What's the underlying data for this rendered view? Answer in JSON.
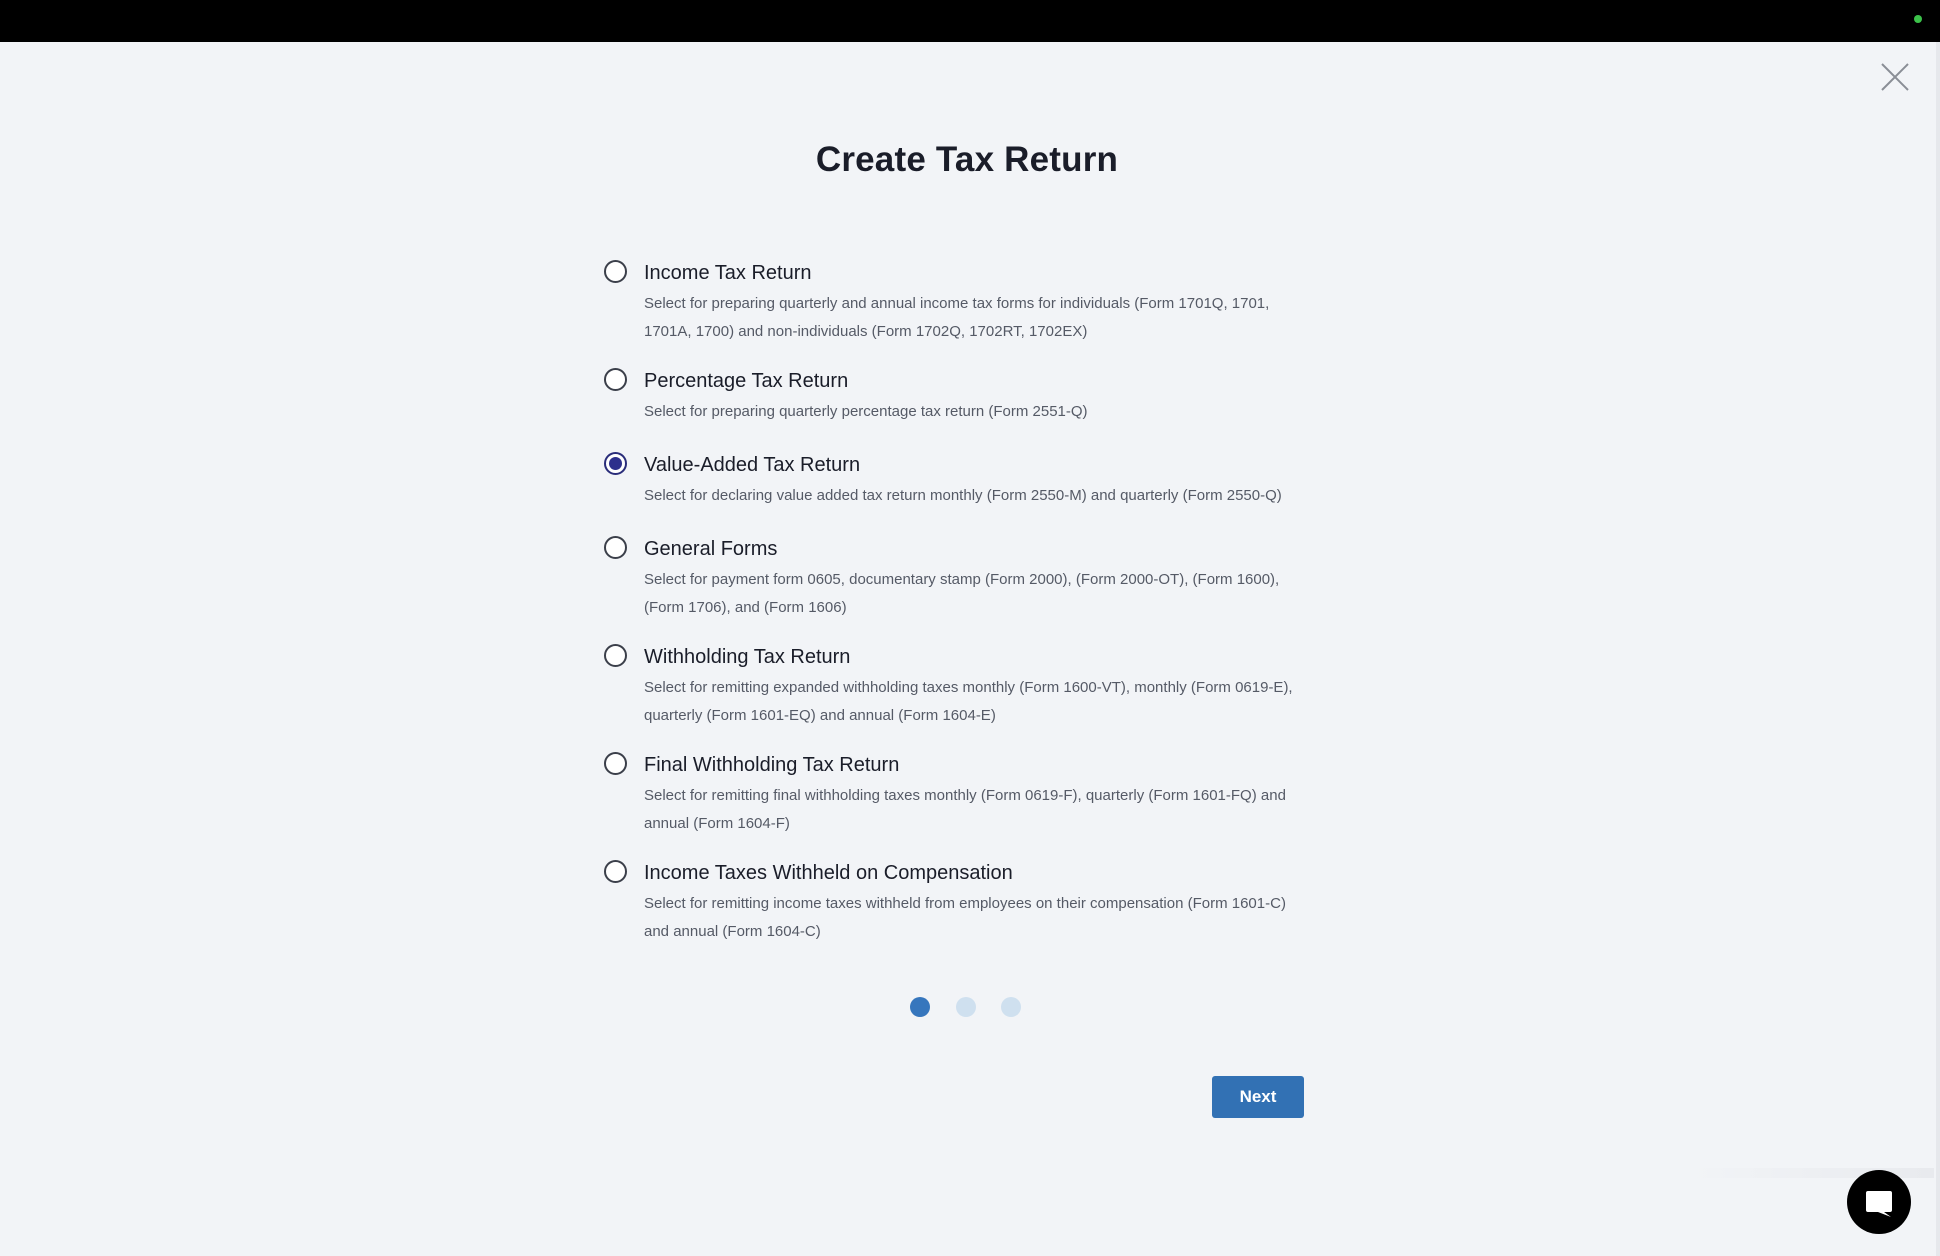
{
  "window": {
    "status_indicator_color": "#3cc24a"
  },
  "dialog": {
    "title": "Create Tax Return",
    "close_icon": "close-icon"
  },
  "options": [
    {
      "title": "Income Tax Return",
      "desc_lines": [
        "Select for preparing quarterly and annual income tax forms for individuals (Form 1701Q, 1701,",
        "1701A, 1700) and non-individuals (Form 1702Q, 1702RT, 1702EX)"
      ],
      "selected": false
    },
    {
      "title": "Percentage Tax Return",
      "desc_lines": [
        "Select for preparing quarterly percentage tax return (Form 2551-Q)"
      ],
      "selected": false
    },
    {
      "title": "Value-Added Tax Return",
      "desc_lines": [
        "Select for declaring value added tax return monthly (Form 2550-M) and quarterly (Form 2550-Q)"
      ],
      "selected": true
    },
    {
      "title": "General Forms",
      "desc_lines": [
        "Select for payment form 0605, documentary stamp (Form 2000), (Form 2000-OT), (Form 1600),",
        "(Form 1706), and (Form 1606)"
      ],
      "selected": false
    },
    {
      "title": "Withholding Tax Return",
      "desc_lines": [
        "Select for remitting expanded withholding taxes monthly (Form 1600-VT), monthly (Form 0619-E),",
        "quarterly (Form 1601-EQ) and annual (Form 1604-E)"
      ],
      "selected": false
    },
    {
      "title": "Final Withholding Tax Return",
      "desc_lines": [
        "Select for remitting final withholding taxes monthly (Form 0619-F), quarterly (Form 1601-FQ) and",
        "annual (Form 1604-F)"
      ],
      "selected": false
    },
    {
      "title": "Income Taxes Withheld on Compensation",
      "desc_lines": [
        "Select for remitting income taxes withheld from employees on their compensation (Form 1601-C)",
        "and annual (Form 1604-C)"
      ],
      "selected": false
    }
  ],
  "pager": {
    "total": 3,
    "current": 1
  },
  "actions": {
    "next_label": "Next"
  },
  "chat": {
    "icon": "chat-bubble-icon"
  },
  "colors": {
    "accent": "#3271b4",
    "radio_selected": "#2d2f8c",
    "pager_active": "#3676bd",
    "pager_inactive": "#cfe0ef",
    "background": "#f2f4f7"
  }
}
